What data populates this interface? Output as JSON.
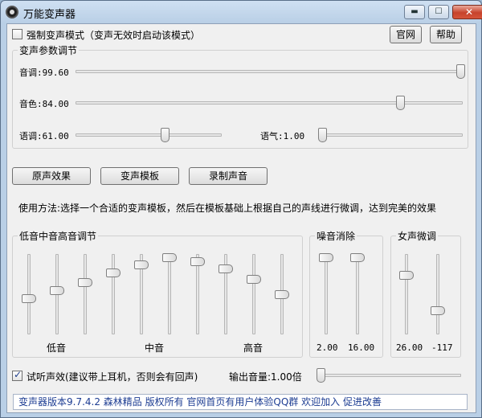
{
  "window": {
    "title": "万能变声器",
    "minimize_glyph": "▬",
    "maximize_glyph": "☐",
    "close_glyph": "✕"
  },
  "top": {
    "force_mode_label": "强制变声模式（变声无效时启动该模式）",
    "force_mode_checked": false,
    "official_button": "官网",
    "help_button": "帮助"
  },
  "params": {
    "title": "变声参数调节",
    "pitch": {
      "label": "音调:99.60",
      "fraction": 0.996
    },
    "timbre": {
      "label": "音色:84.00",
      "fraction": 0.84
    },
    "speed": {
      "label": "语调:61.00",
      "fraction": 0.61
    },
    "tone": {
      "label": "语气:1.00",
      "fraction": 0.0
    }
  },
  "actions": {
    "original_effect": "原声效果",
    "voice_template": "变声模板",
    "record_voice": "录制声音"
  },
  "usage_text": "使用方法:选择一个合适的变声模板，然后在模板基础上根据自己的声线进行微调，达到完美的效果",
  "equalizer": {
    "title": "低音中音高音调节",
    "bands": [
      0.45,
      0.55,
      0.65,
      0.78,
      0.88,
      0.97,
      0.92,
      0.83,
      0.69,
      0.5
    ],
    "low_label": "低音",
    "mid_label": "中音",
    "high_label": "高音"
  },
  "noise": {
    "title": "噪音消除",
    "sliders": [
      {
        "value": "2.00",
        "fraction": 0.97
      },
      {
        "value": "16.00",
        "fraction": 0.97
      }
    ]
  },
  "female": {
    "title": "女声微调",
    "sliders": [
      {
        "value": "26.00",
        "fraction": 0.75
      },
      {
        "value": "-117",
        "fraction": 0.3
      }
    ]
  },
  "monitor": {
    "label": "试听声效(建议带上耳机，否则会有回声)",
    "checked": true
  },
  "output_volume": {
    "label": "输出音量:1.00倍",
    "fraction": 0.0
  },
  "status": "变声器版本9.7.4.2  森林精品 版权所有  官网首页有用户体验QQ群 欢迎加入 促进改善"
}
